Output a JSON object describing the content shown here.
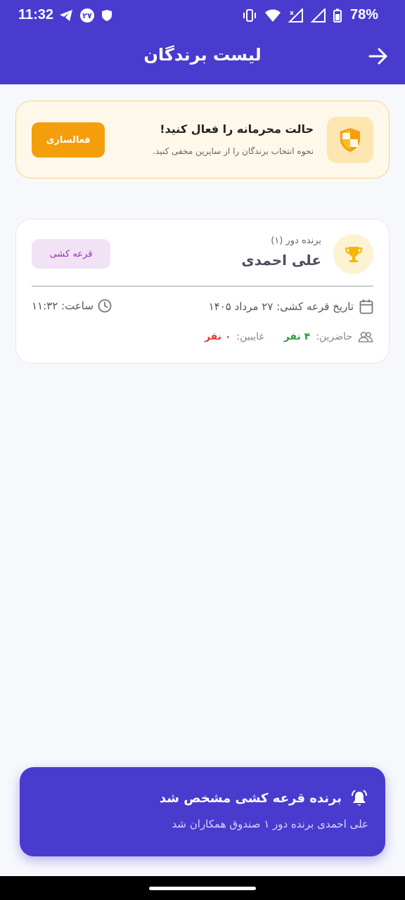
{
  "status_bar": {
    "time": "11:32",
    "badge": "۲۷",
    "battery": "78%"
  },
  "header": {
    "title": "لیست برندگان"
  },
  "privacy_card": {
    "title": "حالت محرمانه را فعال کنید!",
    "subtitle": "نحوه انتخاب برندگان را از سایرین مخفی کنید.",
    "button": "فعالسازی"
  },
  "winner_card": {
    "round_label": "برنده دور (۱)",
    "winner_name": "علی احمدی",
    "tag": "قرعه کشی",
    "date_text": "تاریخ قرعه کشی: ۲۷ مرداد ۱۴۰۵",
    "time_text": "ساعت: ۱۱:۳۲",
    "present_label": "حاضرین:",
    "present_value": "۴ نفر",
    "absent_label": "غایبین:",
    "absent_value": "۰ نفر"
  },
  "toast": {
    "title": "برنده قرعه کشی مشخص شد",
    "message": "علی احمدی برنده دور ۱ صندوق همکاران شد"
  },
  "colors": {
    "primary": "#4a3bcf",
    "warning_accent": "#f59e0b",
    "present": "#2e9e3e",
    "absent": "#e53935"
  }
}
